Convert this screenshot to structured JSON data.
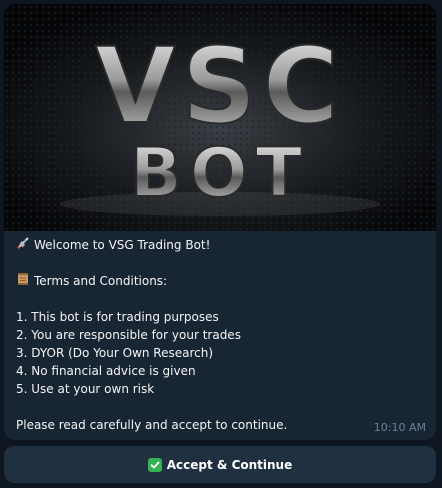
{
  "message": {
    "banner": {
      "logo_lines": [
        "VSC",
        "BOT"
      ]
    },
    "lines": [
      {
        "icon": "rocket-icon",
        "text": "Welcome to VSG Trading Bot!"
      },
      {
        "text": ""
      },
      {
        "icon": "scroll-icon",
        "text": "Terms and Conditions:"
      },
      {
        "text": ""
      },
      {
        "text": "1. This bot is for trading purposes"
      },
      {
        "text": "2. You are responsible for your trades"
      },
      {
        "text": "3. DYOR (Do Your Own Research)"
      },
      {
        "text": "4. No financial advice is given"
      },
      {
        "text": "5. Use at your own risk"
      },
      {
        "text": ""
      },
      {
        "text": "Please read carefully and accept to continue."
      }
    ],
    "timestamp": "10:10 AM"
  },
  "button": {
    "icon": "check-mark-icon",
    "label": "Accept & Continue"
  },
  "colors": {
    "background": "#0e1621",
    "bubble": "#182533",
    "button": "#203040",
    "accent_check": "#33b351"
  }
}
